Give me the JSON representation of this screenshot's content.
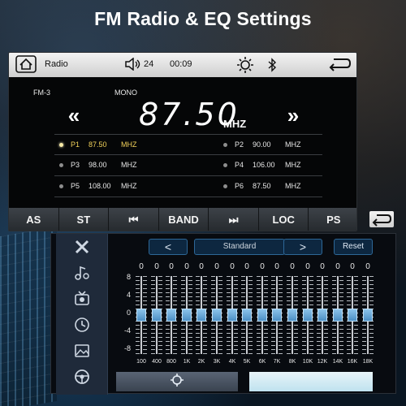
{
  "headline": "FM Radio & EQ Settings",
  "radio": {
    "topbar": {
      "app_name": "Radio",
      "volume": "24",
      "clock": "00:09",
      "icons": [
        "home-icon",
        "volume-icon",
        "brightness-icon",
        "bluetooth-icon",
        "back-icon"
      ]
    },
    "band": "FM-3",
    "stereo_mode": "MONO",
    "frequency": "87.50",
    "unit": "MHZ",
    "seek_back": "«",
    "seek_forward": "»",
    "presets": [
      {
        "id": "P1",
        "value": "87.50",
        "unit": "MHZ",
        "active": true
      },
      {
        "id": "P2",
        "value": "90.00",
        "unit": "MHZ",
        "active": false
      },
      {
        "id": "P3",
        "value": "98.00",
        "unit": "MHZ",
        "active": false
      },
      {
        "id": "P4",
        "value": "106.00",
        "unit": "MHZ",
        "active": false
      },
      {
        "id": "P5",
        "value": "108.00",
        "unit": "MHZ",
        "active": false
      },
      {
        "id": "P6",
        "value": "87.50",
        "unit": "MHZ",
        "active": false
      }
    ],
    "softkeys": [
      "AS",
      "ST",
      "⏮",
      "BAND",
      "⏭",
      "LOC",
      "PS"
    ]
  },
  "eq": {
    "sidebar_icons": [
      "tools-icon",
      "music-settings-icon",
      "tv-icon",
      "clock-icon",
      "image-icon",
      "steering-wheel-icon"
    ],
    "prev_label": "<",
    "next_label": ">",
    "preset_name": "Standard",
    "reset_label": "Reset",
    "scale_labels": [
      "8",
      "4",
      "0",
      "-4",
      "-8"
    ],
    "band_values": [
      "0",
      "0",
      "0",
      "0",
      "0",
      "0",
      "0",
      "0",
      "0",
      "0",
      "0",
      "0",
      "0",
      "0",
      "0",
      "0"
    ],
    "band_levels": [
      0,
      0,
      0,
      0,
      0,
      0,
      0,
      0,
      0,
      0,
      0,
      0,
      0,
      0,
      0,
      0
    ],
    "band_freqs": [
      "100",
      "400",
      "800",
      "1K",
      "2K",
      "3K",
      "4K",
      "5K",
      "6K",
      "7K",
      "8K",
      "10K",
      "12K",
      "14K",
      "16K",
      "18K"
    ],
    "bottom_left_icon": "crosshair-icon"
  },
  "colors": {
    "active_preset": "#f2d25a",
    "eq_accent": "#2d6797",
    "knob": "#6aa9d8"
  }
}
